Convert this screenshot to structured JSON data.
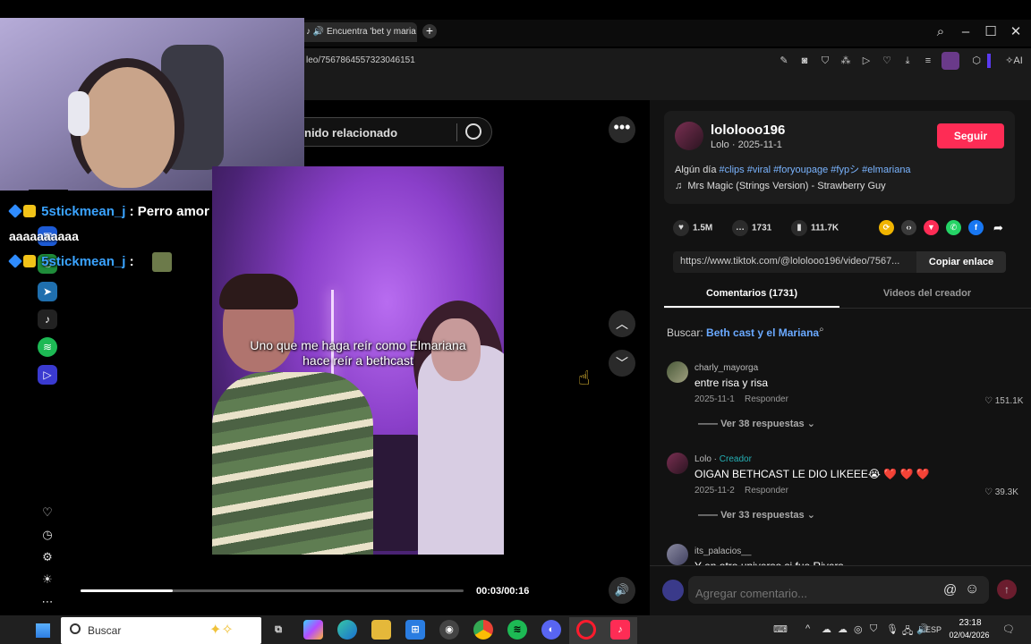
{
  "browser": {
    "tab_title": "Encuentra 'bet y maria",
    "url": "leo/7567864557323046151",
    "ai_label": "AI"
  },
  "stream_chat": {
    "line1_user": "5stickmean_j",
    "line1_sep": " : ",
    "line1_msg": "Perro amor todo",
    "line1_cont": "aaaaaaaaaa",
    "line2_user": "5stickmean_j",
    "line2_sep": " :"
  },
  "search": {
    "text": "nido relacionado"
  },
  "video": {
    "caption": "Uno que me haga reír como Elmariana hace reír a bethcast",
    "time": "00:03/00:16",
    "progress": 0.24
  },
  "post": {
    "handle": "lolol​ooo196",
    "sub": "Lolo · 2025-11-1",
    "follow_label": "Seguir",
    "desc_prefix": "Algún día",
    "tags": "#clips #viral #foryoupage #fypシ #elmariana",
    "music": "Mrs Magic (Strings Version) - Strawberry Guy",
    "likes": "1.5M",
    "comments": "1731",
    "saves": "111.7K",
    "link": "https://www.tiktok.com/@lolol​ooo196/video/7567...",
    "copy_label": "Copiar enlace"
  },
  "tabs": {
    "comments": "Comentarios (1731)",
    "videos": "Videos del creador"
  },
  "search_suggest": {
    "label": "Buscar:",
    "query": "Beth cast y el Mariana"
  },
  "comments": [
    {
      "user": "charly_mayorga",
      "text": "entre risa y risa",
      "date": "2025-11-1",
      "reply": "Responder",
      "likes": "151.1K",
      "replies": "Ver 38 respuestas"
    },
    {
      "user": "Lolo",
      "creator": "Creador",
      "text": "OIGAN BETHCAST LE DIO LIKEEE😭 ❤️ ❤️ ❤️",
      "date": "2025-11-2",
      "reply": "Responder",
      "likes": "39.3K",
      "replies": "Ver 33 respuestas"
    },
    {
      "user": "its_palacios__",
      "text": "Y en otro universo si fue Rivers"
    }
  ],
  "comment_input": {
    "placeholder": "Agregar comentario..."
  },
  "taskbar": {
    "search": "Buscar",
    "lang": "ESP",
    "time": "23:18",
    "date": "02/04/2026"
  },
  "colors": {
    "follow": "#fe2c55",
    "tag": "#7ab4ff",
    "creator": "#25b0b5",
    "chat_user": "#3aa3ff"
  }
}
